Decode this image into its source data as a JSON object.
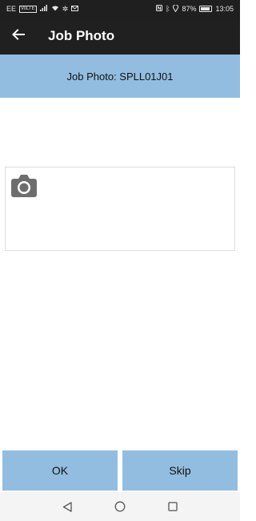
{
  "status_bar": {
    "carrier": "EE",
    "volte": "VoLTE",
    "battery_percent": "87%",
    "time": "13:05",
    "icons": [
      "signal-icon",
      "wifi-icon",
      "settings-icon",
      "mail-icon",
      "nfc-icon",
      "bluetooth-icon",
      "location-icon",
      "battery-icon"
    ]
  },
  "app_bar": {
    "title": "Job Photo",
    "back_icon": "arrow-back-icon"
  },
  "header": {
    "text": "Job Photo: SPLL01J01"
  },
  "photo": {
    "icon": "camera-icon"
  },
  "buttons": {
    "ok_label": "OK",
    "skip_label": "Skip"
  },
  "colors": {
    "accent_blue": "#92bde0",
    "app_bar": "#202020",
    "status_bar": "#1f1f1f",
    "camera_icon": "#6e6e6e"
  },
  "nav_bar": {
    "icons": [
      "nav-back-icon",
      "nav-home-icon",
      "nav-recents-icon"
    ]
  }
}
